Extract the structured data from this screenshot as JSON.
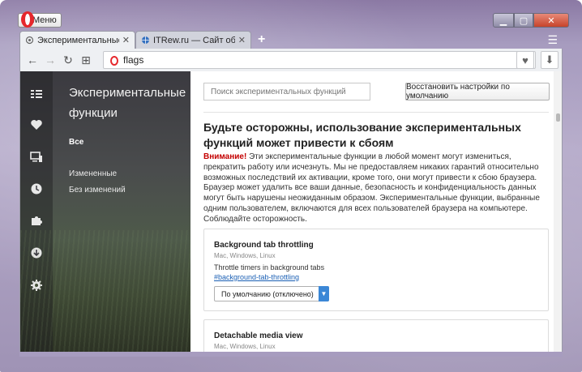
{
  "window": {
    "menu_label": "Меню",
    "controls": {
      "minimize": "▁",
      "maximize": "▢",
      "close": "✕"
    }
  },
  "tabs": [
    {
      "title": "Экспериментальные функ",
      "close": "✕",
      "icon": "flask-icon"
    },
    {
      "title": "ITRew.ru — Сайт об IT для",
      "close": "✕",
      "icon": "globe-icon"
    }
  ],
  "new_tab": "+",
  "toolbar": {
    "back": "←",
    "forward": "→",
    "reload": "↻",
    "speed_dial": "⊞",
    "url": "flags",
    "heart": "♥",
    "download": "⬇"
  },
  "sidebar": {
    "icons": [
      "speed-dial-icon",
      "heart-icon",
      "devices-icon",
      "history-icon",
      "extensions-icon",
      "download-icon",
      "settings-icon"
    ],
    "title": "Экспериментальные функции",
    "links": [
      {
        "label": "Все",
        "active": true
      },
      {
        "label": "Измененные",
        "active": false
      },
      {
        "label": "Без изменений",
        "active": false
      }
    ]
  },
  "main": {
    "search_placeholder": "Поиск экспериментальных функций",
    "reset_label": "Восстановить настройки по умолчанию",
    "warning_title": "Будьте осторожны, использование экспериментальных функций может привести к сбоям",
    "warning_attention": "Внимание!",
    "warning_text": " Эти экспериментальные функции в любой момент могут измениться, прекратить работу или исчезнуть. Мы не предоставляем никаких гарантий относительно возможных последствий их активации, кроме того, они могут привести к сбою браузера. Браузер может удалить все ваши данные, безопасность и конфиденциальность данных могут быть нарушены неожиданным образом. Экспериментальные функции, выбранные одним пользователем, включаются для всех пользователей браузера на компьютере. Соблюдайте осторожность.",
    "cards": [
      {
        "title": "Background tab throttling",
        "platforms": "Mac, Windows, Linux",
        "description": "Throttle timers in background tabs",
        "link": "#background-tab-throttling",
        "select_value": "По умолчанию (отключено)"
      },
      {
        "title": "Detachable media view",
        "platforms": "Mac, Windows, Linux"
      }
    ]
  },
  "colors": {
    "opera_red": "#e6272c",
    "link_blue": "#1a5fb4",
    "warning_red": "#c40000",
    "select_arrow": "#3b87d6"
  }
}
